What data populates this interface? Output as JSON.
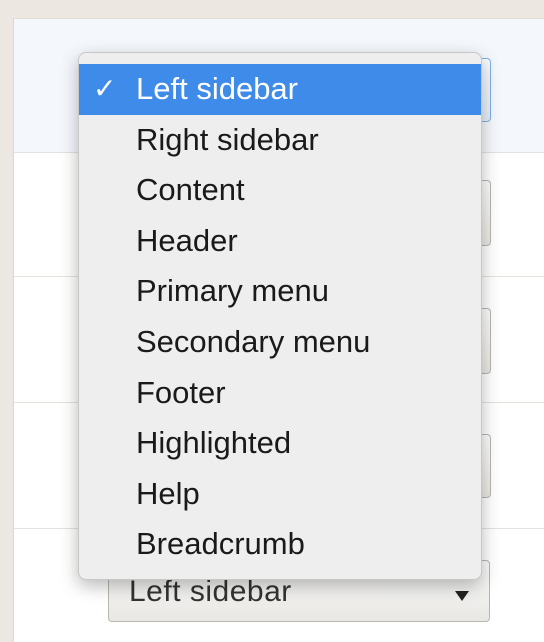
{
  "dropdown": {
    "selected_index": 0,
    "check_glyph": "✓",
    "options": [
      "Left sidebar",
      "Right sidebar",
      "Content",
      "Header",
      "Primary menu",
      "Secondary menu",
      "Footer",
      "Highlighted",
      "Help",
      "Breadcrumb"
    ]
  },
  "bottom_select": {
    "value": "Left sidebar"
  },
  "colors": {
    "selected_highlight": "#3e8bea",
    "menu_background": "#efeeee",
    "page_background": "#ece8e1"
  },
  "icons": {
    "check": "checkmark-icon",
    "arrow": "chevron-down-icon"
  }
}
